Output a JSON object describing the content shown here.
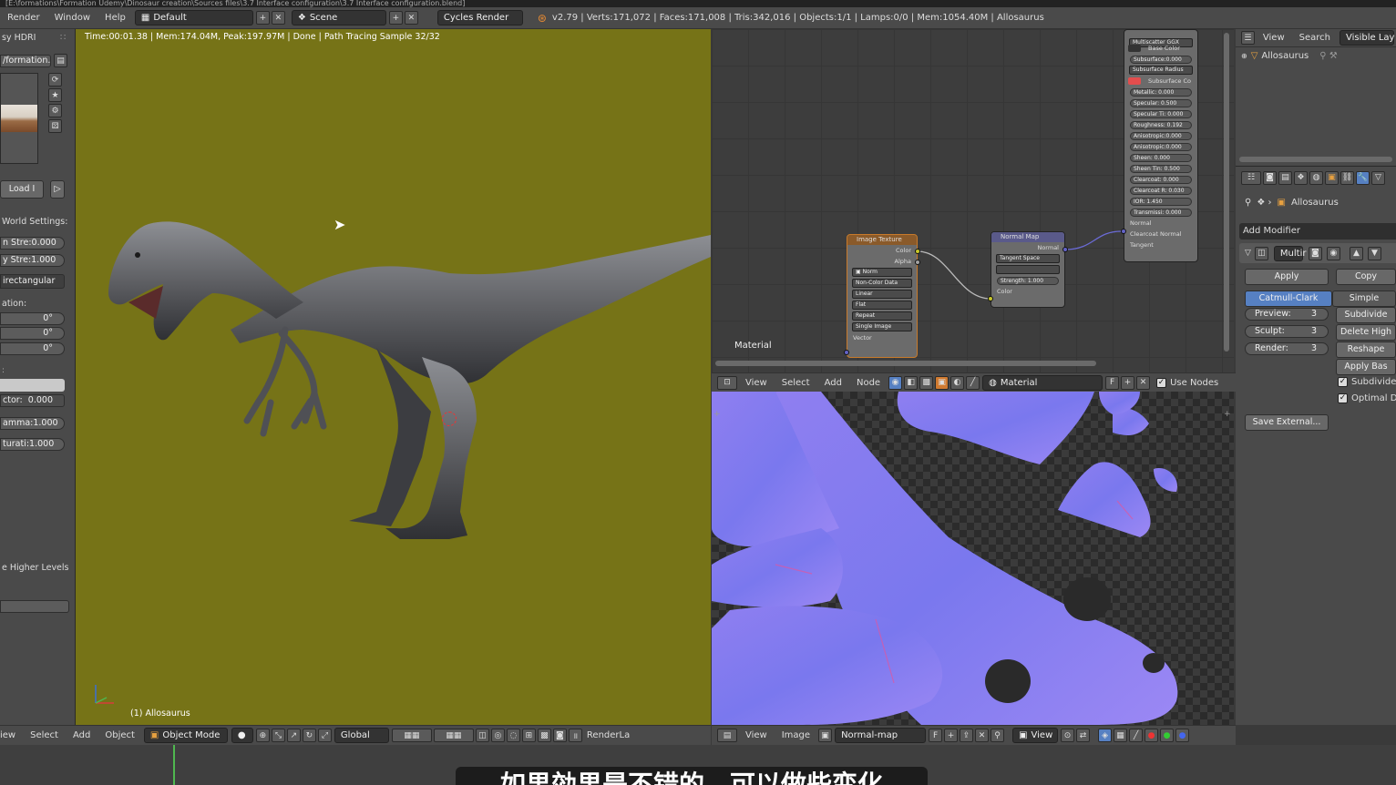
{
  "window": {
    "title": "[E:\\formations\\Formation Udemy\\Dinosaur creation\\Sources files\\3.7 Interface configuration\\3.7 Interface configuration.blend]"
  },
  "topbar": {
    "menus": [
      "Render",
      "Window",
      "Help"
    ],
    "layout": "Default",
    "scene": "Scene",
    "engine": "Cycles Render",
    "stats": "v2.79 | Verts:171,072 | Faces:171,008 | Tris:342,016 | Objects:1/1 | Lamps:0/0 | Mem:1054.40M | Allosaurus"
  },
  "leftpanel": {
    "header": "sy HDRI",
    "image_name": "/formation...",
    "load_label": "Load I",
    "world_settings": "World Settings:",
    "fields": [
      {
        "label": "n Stre:",
        "value": "0.000"
      },
      {
        "label": "y Stre:",
        "value": "1.000"
      }
    ],
    "projection": "irectangular",
    "rotation_label": "ation:",
    "rotations": [
      "0°",
      "0°",
      "0°"
    ],
    "factor": {
      "label": "ctor:",
      "value": "0.000"
    },
    "gamma": {
      "label": "amma:",
      "value": "1.000"
    },
    "saturation": {
      "label": "turati:",
      "value": "1.000"
    },
    "higher_levels": "e Higher Levels"
  },
  "viewport": {
    "info": "Time:00:01.38 | Mem:174.04M, Peak:197.97M | Done | Path Tracing Sample 32/32",
    "object_label": "(1) Allosaurus",
    "header": {
      "menus": [
        "iew",
        "Select",
        "Add",
        "Object"
      ],
      "mode": "Object Mode",
      "orientation": "Global",
      "render_layer": "RenderLa"
    }
  },
  "node_editor": {
    "material_label": "Material",
    "principled": {
      "distribution": "Multiscatter GGX",
      "base_color": "Base Color",
      "fields": [
        "Subsurface:0.000",
        "Subsurface Radius",
        "Subsurface Co",
        "Metallic:     0.000",
        "Specular:     0.500",
        "Specular Ti:  0.000",
        "Roughness:  0.192",
        "Anisotropic:0.000",
        "Anisotropic:0.000",
        "Sheen:         0.000",
        "Sheen Tin:  0.500",
        "Clearcoat:   0.000",
        "Clearcoat R: 0.030",
        "IOR:           1.450",
        "Transmissi: 0.000"
      ],
      "inputs": [
        "Normal",
        "Clearcoat Normal",
        "Tangent"
      ]
    },
    "image_texture": {
      "title": "Image Texture",
      "outputs": [
        "Color",
        "Alpha"
      ],
      "image": "Norm",
      "color_space": "Non-Color Data",
      "interpolation": "Linear",
      "projection": "Flat",
      "extension": "Repeat",
      "source": "Single Image",
      "input": "Vector"
    },
    "normal_map": {
      "title": "Normal Map",
      "output": "Normal",
      "space": "Tangent Space",
      "strength": "Strength:     1.000",
      "input": "Color"
    },
    "header": {
      "menus": [
        "View",
        "Select",
        "Add",
        "Node"
      ],
      "material": "Material",
      "use_nodes": "Use Nodes"
    }
  },
  "image_editor": {
    "header": {
      "menus": [
        "View",
        "Image"
      ],
      "image": "Normal-map",
      "view": "View"
    }
  },
  "outliner": {
    "menus": [
      "View",
      "Search"
    ],
    "visible": "Visible Lay",
    "object": "Allosaurus"
  },
  "properties": {
    "object": "Allosaurus",
    "add_modifier": "Add Modifier",
    "modifier_name": "Multir",
    "apply": "Apply",
    "copy": "Copy",
    "catmull": "Catmull-Clark",
    "simple": "Simple",
    "levels": [
      {
        "label": "Preview:",
        "value": "3"
      },
      {
        "label": "Sculpt:",
        "value": "3"
      },
      {
        "label": "Render:",
        "value": "3"
      }
    ],
    "right_buttons": [
      "Subdivide",
      "Delete High",
      "Reshape",
      "Apply Bas"
    ],
    "checks": [
      "Subdivide U",
      "Optimal Di"
    ],
    "save_external": "Save External..."
  },
  "subtitle": {
    "text": "如果効果是不错的，可以做些变化"
  },
  "colors": {
    "viewport_bg": "#767317",
    "accent": "#5680c2",
    "header": "#4a4a4a"
  }
}
